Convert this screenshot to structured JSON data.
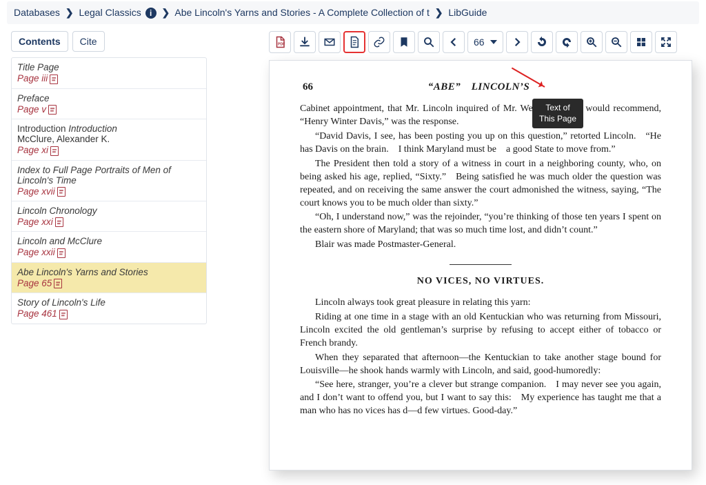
{
  "breadcrumb": {
    "databases": "Databases",
    "legal": "Legal Classics",
    "title": "Abe Lincoln's Yarns and Stories - A Complete Collection of t",
    "libguide": "LibGuide"
  },
  "sidebar": {
    "contents_btn": "Contents",
    "cite_btn": "Cite",
    "items": [
      {
        "title": "Title Page",
        "page": "Page iii"
      },
      {
        "title": "Preface",
        "page": "Page v"
      },
      {
        "title": "Introduction Introduction",
        "author": "McClure, Alexander K.",
        "page": "Page xi"
      },
      {
        "title": "Index to Full Page Portraits of Men of Lincoln's Time",
        "page": "Page xvii"
      },
      {
        "title": "Lincoln Chronology",
        "page": "Page xxi"
      },
      {
        "title": "Lincoln and McClure",
        "page": "Page xxii"
      },
      {
        "title": "Abe Lincoln's Yarns and Stories",
        "page": "Page 65"
      },
      {
        "title": "Story of Lincoln's Life",
        "page": "Page 461"
      }
    ]
  },
  "toolbar": {
    "page_number": "66",
    "tooltip_line1": "Text of",
    "tooltip_line2": "This Page"
  },
  "page": {
    "number": "66",
    "header": "“ABE” LINCOLN’S",
    "p1": "Cabinet appointment, that Mr. Lincoln inquired of Mr. Weed whom he would recommend, “Henry Winter Davis,” was the response.",
    "p2": "“David Davis, I see, has been posting you up on this question,” retorted Lincoln. “He has Davis on the brain. I think Maryland must be a good State to move from.”",
    "p3": "The President then told a story of a witness in court in a neighboring county, who, on being asked his age, replied, “Sixty.” Being satisfied he was much older the question was repeated, and on receiving the same answer the court admonished the witness, saying, “The court knows you to be much older than sixty.”",
    "p4": "“Oh, I understand now,” was the rejoinder, “you’re thinking of those ten years I spent on the eastern shore of Maryland; that was so much time lost, and didn’t count.”",
    "p5": "Blair was made Postmaster-General.",
    "section": "NO VICES, NO VIRTUES.",
    "p6": "Lincoln always took great pleasure in relating this yarn:",
    "p7": "Riding at one time in a stage with an old Kentuckian who was returning from Missouri, Lincoln excited the old gentleman’s surprise by refusing to accept either of tobacco or French brandy.",
    "p8": "When they separated that afternoon—the Kentuckian to take another stage bound for Louisville—he shook hands warmly with Lincoln, and said, good-humoredly:",
    "p9": "“See here, stranger, you’re a clever but strange companion. I may never see you again, and I don’t want to offend you, but I want to say this: My experience has taught me that a man who has no vices has d—d few virtues. Good-day.”"
  }
}
